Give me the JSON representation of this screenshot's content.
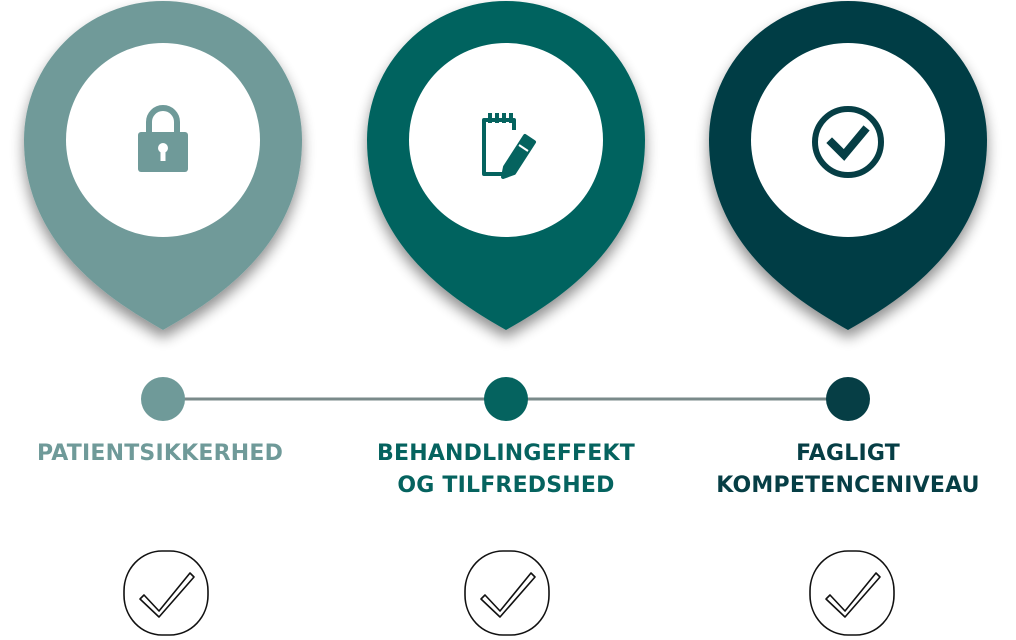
{
  "colors": {
    "pin_light": "#6f9a99",
    "pin_mid": "#05635f",
    "pin_dark": "#063e45",
    "timeline_line": "#7a8a8a",
    "background": "#ffffff"
  },
  "steps": [
    {
      "icon": "padlock-icon",
      "color": "#6f9a99",
      "label_lines": [
        "PATIENTSIKKERHED"
      ]
    },
    {
      "icon": "notepad-pencil-icon",
      "color": "#05635f",
      "label_lines": [
        "BEHANDLINGEFFEKT",
        "OG TILFREDSHED"
      ]
    },
    {
      "icon": "check-circle-icon",
      "color": "#063e45",
      "label_lines": [
        "FAGLIGT",
        "KOMPETENCENIVEAU"
      ]
    }
  ],
  "bottom_checks": [
    "checkmark-icon",
    "checkmark-icon",
    "checkmark-icon"
  ]
}
